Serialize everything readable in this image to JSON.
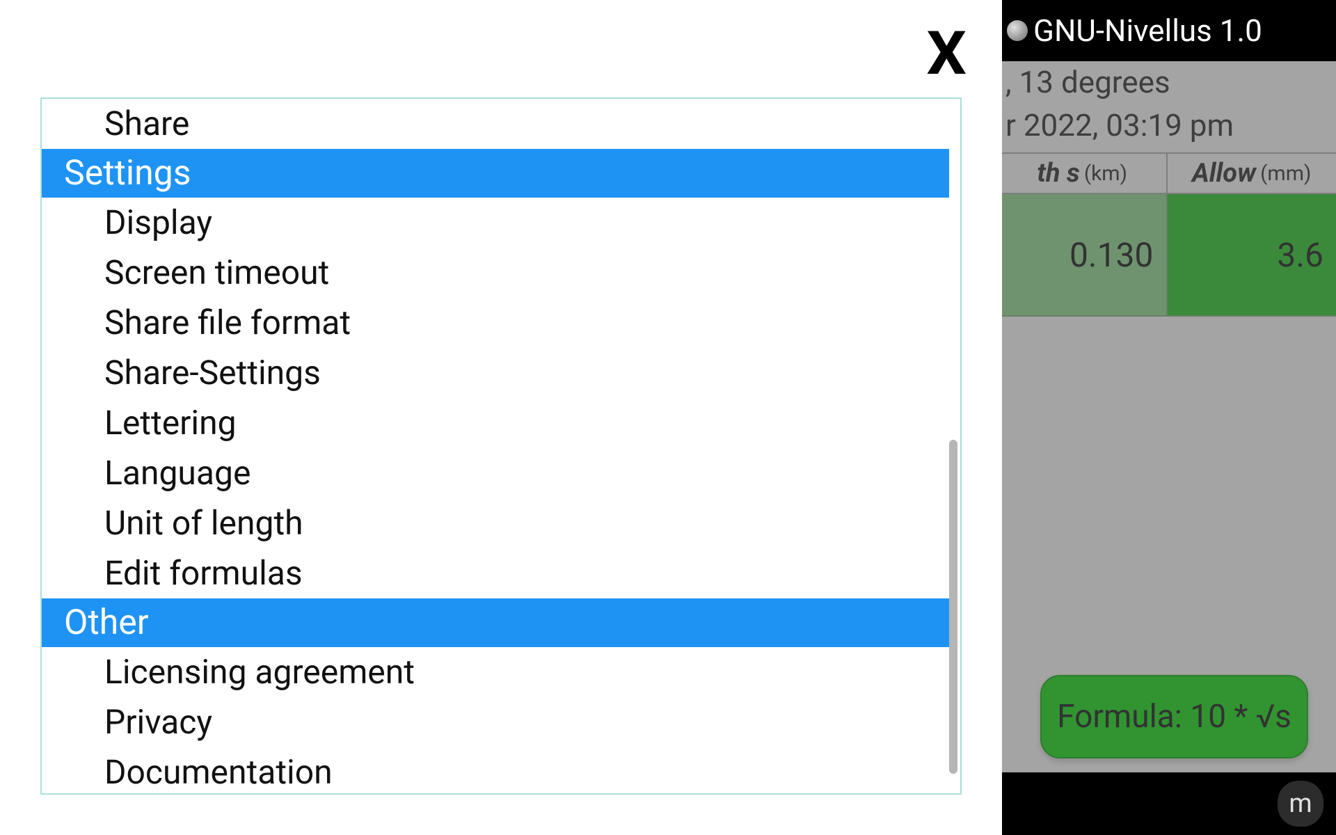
{
  "app": {
    "title": "GNU-Nivellus 1.0",
    "info_line1": ", 13 degrees",
    "info_line2": "r 2022, 03:19 pm"
  },
  "table": {
    "columns": [
      {
        "label": "th s",
        "unit": "(km)"
      },
      {
        "label": "Allow",
        "unit": "(mm)"
      }
    ],
    "row": [
      "0.130",
      "3.6"
    ]
  },
  "formula_button": "Formula: 10 * √s",
  "bottom_badge": "m",
  "close_label": "X",
  "menu": {
    "items": [
      {
        "label": "Share",
        "type": "item"
      },
      {
        "label": "Settings",
        "type": "header"
      },
      {
        "label": "Display",
        "type": "item"
      },
      {
        "label": "Screen timeout",
        "type": "item"
      },
      {
        "label": "Share file format",
        "type": "item"
      },
      {
        "label": "Share-Settings",
        "type": "item"
      },
      {
        "label": "Lettering",
        "type": "item"
      },
      {
        "label": "Language",
        "type": "item"
      },
      {
        "label": "Unit of length",
        "type": "item"
      },
      {
        "label": "Edit formulas",
        "type": "item"
      },
      {
        "label": "Other",
        "type": "header"
      },
      {
        "label": "Licensing agreement",
        "type": "item"
      },
      {
        "label": "Privacy",
        "type": "item"
      },
      {
        "label": "Documentation",
        "type": "item"
      }
    ]
  }
}
